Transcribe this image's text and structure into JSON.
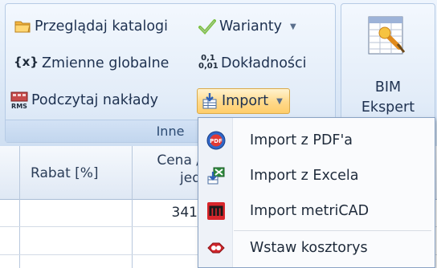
{
  "ribbon": {
    "group_inne": {
      "label": "Inne",
      "buttons": {
        "przegladaj": "Przeglądaj katalogi",
        "warianty": "Warianty",
        "zmienne": "Zmienne globalne",
        "dokladnosci": "Dokładności",
        "podczytaj": "Podczytaj nakłady",
        "import": "Import"
      },
      "icon_text": {
        "zmienne": "{x}",
        "dokladnosci_top": "0,1",
        "dokladnosci_bottom": "0,01",
        "podczytaj": "RMS"
      }
    },
    "group_bim": {
      "label_line1": "BIM",
      "label_line2": "Ekspert"
    }
  },
  "table": {
    "headers": {
      "rabat": "Rabat [%]",
      "cena_line1": "Cena /",
      "cena_line2": "jed"
    },
    "rows": [
      {
        "rabat": "",
        "cena": "341"
      },
      {
        "rabat": "",
        "cena": ""
      }
    ]
  },
  "import_menu": {
    "items": [
      {
        "label": "Import z PDF'a",
        "icon": "pdf-icon"
      },
      {
        "label": "Import z Excela",
        "icon": "excel-import-icon"
      },
      {
        "label": "Import metriCAD",
        "icon": "metricad-icon"
      },
      {
        "label": "Wstaw kosztorys",
        "icon": "insert-estimate-icon"
      }
    ]
  },
  "colors": {
    "ribbon_bg": "#dde9f7",
    "import_highlight": "#ffd98a",
    "menu_border": "#8aa3c4"
  }
}
